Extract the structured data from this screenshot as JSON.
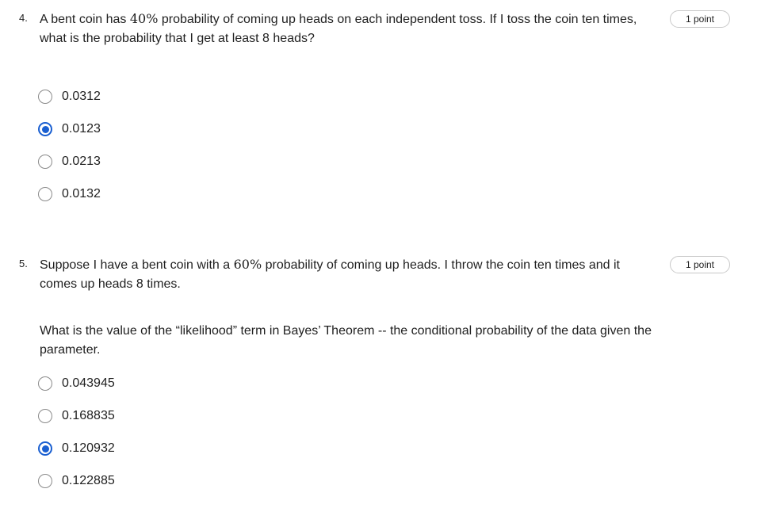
{
  "questions": [
    {
      "number": "4.",
      "text_before": "A bent coin has ",
      "math": "40%",
      "text_after": " probability of coming up heads on each independent toss. If I toss the coin ten times, what is the probability that I get at least 8 heads?",
      "points": "1 point",
      "options": [
        {
          "label": "0.0312",
          "selected": false
        },
        {
          "label": "0.0123",
          "selected": true
        },
        {
          "label": "0.0213",
          "selected": false
        },
        {
          "label": "0.0132",
          "selected": false
        }
      ]
    },
    {
      "number": "5.",
      "text_before": "Suppose I have a bent coin with a ",
      "math": "60%",
      "text_after": " probability of coming up heads. I throw the coin ten times and it comes up heads 8 times.",
      "subtext": "What is the value of the “likelihood” term in Bayes’ Theorem -- the conditional probability of the data given the parameter.",
      "points": "1 point",
      "options": [
        {
          "label": "0.043945",
          "selected": false
        },
        {
          "label": "0.168835",
          "selected": false
        },
        {
          "label": "0.120932",
          "selected": true
        },
        {
          "label": "0.122885",
          "selected": false
        }
      ]
    }
  ],
  "colors": {
    "accent": "#1a5fd1",
    "text": "#1f1f1f",
    "radio_border": "#8a8a8a",
    "badge_border": "#c8c8c8"
  }
}
